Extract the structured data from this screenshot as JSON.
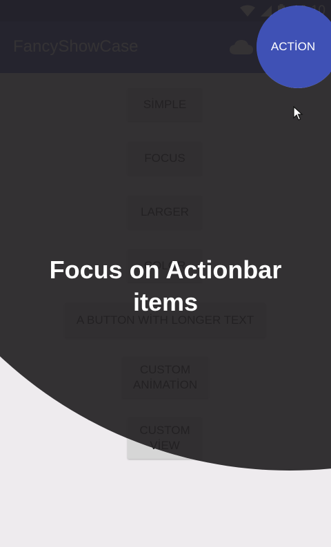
{
  "status_bar": {
    "time": "19:10",
    "color": "#2e3192"
  },
  "app_bar": {
    "title": "FancyShowCase",
    "action_label": "ACTİON",
    "cloud_icon": "cloud-icon",
    "color": "#3f51b5"
  },
  "buttons": [
    {
      "label": "SİMPLE"
    },
    {
      "label": "FOCUS"
    },
    {
      "label": "LARGER"
    },
    {
      "label": "COLOR"
    },
    {
      "label": "A BUTTON WİTH LONGER TEXT"
    },
    {
      "label_line1": "CUSTOM",
      "label_line2": "ANİMATİON"
    },
    {
      "label_line1": "CUSTOM",
      "label_line2": "VİEW"
    }
  ],
  "showcase": {
    "title": "Focus on Actionbar items",
    "overlay_color": "#2f2d2f",
    "focus_color": "#3f51b5"
  }
}
